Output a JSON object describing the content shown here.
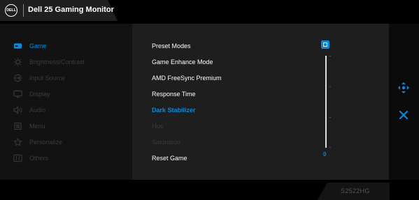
{
  "header": {
    "logo_text": "DELL",
    "title": "Dell 25 Gaming Monitor"
  },
  "sidebar": {
    "items": [
      {
        "label": "Game",
        "icon": "gamepad-icon",
        "active": true
      },
      {
        "label": "Brightness/Contrast",
        "icon": "brightness-icon",
        "active": false
      },
      {
        "label": "Input Source",
        "icon": "input-source-icon",
        "active": false
      },
      {
        "label": "Display",
        "icon": "display-icon",
        "active": false
      },
      {
        "label": "Audio",
        "icon": "speaker-icon",
        "active": false
      },
      {
        "label": "Menu",
        "icon": "menu-icon",
        "active": false
      },
      {
        "label": "Personalize",
        "icon": "star-icon",
        "active": false
      },
      {
        "label": "Others",
        "icon": "others-icon",
        "active": false
      }
    ]
  },
  "game_menu": {
    "rows": [
      {
        "label": "Preset Modes",
        "state": "normal"
      },
      {
        "label": "Game Enhance Mode",
        "state": "normal"
      },
      {
        "label": "AMD FreeSync Premium",
        "state": "normal"
      },
      {
        "label": "Response Time",
        "state": "normal"
      },
      {
        "label": "Dark Stabilizer",
        "state": "selected"
      },
      {
        "label": "Hue",
        "state": "disabled"
      },
      {
        "label": "Saturation",
        "state": "disabled"
      },
      {
        "label": "Reset Game",
        "state": "normal"
      }
    ],
    "dark_stabilizer_value": "0",
    "preset_icon": "preset-mode-icon"
  },
  "nav": {
    "move_icon": "navigate-arrows-icon",
    "close_icon": "close-icon"
  },
  "footer": {
    "model": "S2522HG"
  },
  "colors": {
    "accent": "#0b88d8",
    "sidebar_bg": "#121212",
    "content_bg": "#1e1e1e",
    "disabled_text": "#3c3c3c"
  }
}
